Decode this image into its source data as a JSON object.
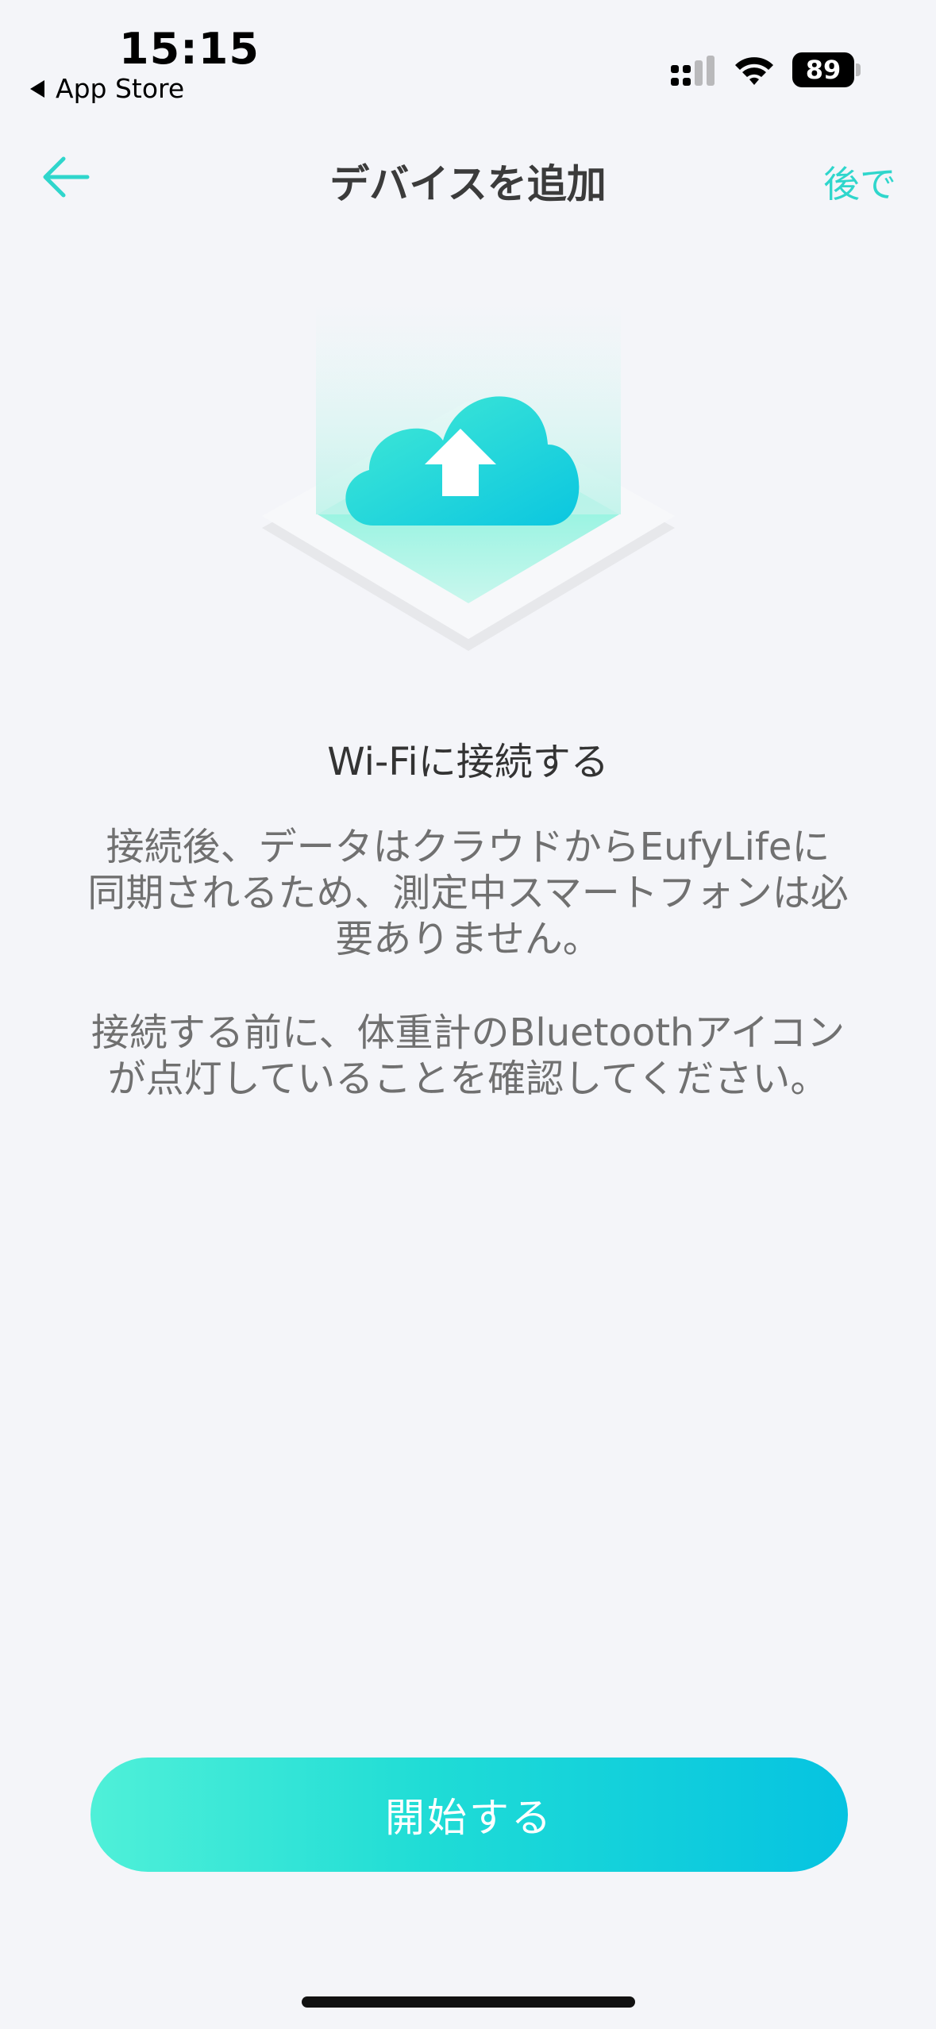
{
  "status_bar": {
    "time": "15:15",
    "back_app": "App Store",
    "battery": "89"
  },
  "nav": {
    "title": "デバイスを追加",
    "later": "後で"
  },
  "content": {
    "heading": "Wi-Fiに接続する",
    "paragraph1": "接続後、データはクラウドからEufyLifeに同期されるため、測定中スマートフォンは必要ありません。",
    "paragraph2": "接続する前に、体重計のBluetoothアイコンが点灯していることを確認してください。"
  },
  "button": {
    "start": "開始する"
  },
  "colors": {
    "accent": "#2fd6cc",
    "gradient_start": "#4ff0d8",
    "gradient_end": "#06c3e1",
    "background": "#f4f5f9"
  },
  "icons": {
    "back": "arrow-left-icon",
    "illustration": "cloud-upload-icon"
  }
}
